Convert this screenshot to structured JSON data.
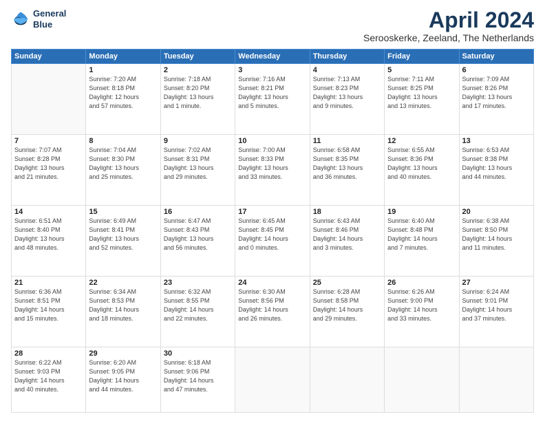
{
  "logo": {
    "line1": "General",
    "line2": "Blue"
  },
  "title": "April 2024",
  "subtitle": "Serooskerke, Zeeland, The Netherlands",
  "days_header": [
    "Sunday",
    "Monday",
    "Tuesday",
    "Wednesday",
    "Thursday",
    "Friday",
    "Saturday"
  ],
  "weeks": [
    [
      {
        "day": "",
        "info": ""
      },
      {
        "day": "1",
        "info": "Sunrise: 7:20 AM\nSunset: 8:18 PM\nDaylight: 12 hours\nand 57 minutes."
      },
      {
        "day": "2",
        "info": "Sunrise: 7:18 AM\nSunset: 8:20 PM\nDaylight: 13 hours\nand 1 minute."
      },
      {
        "day": "3",
        "info": "Sunrise: 7:16 AM\nSunset: 8:21 PM\nDaylight: 13 hours\nand 5 minutes."
      },
      {
        "day": "4",
        "info": "Sunrise: 7:13 AM\nSunset: 8:23 PM\nDaylight: 13 hours\nand 9 minutes."
      },
      {
        "day": "5",
        "info": "Sunrise: 7:11 AM\nSunset: 8:25 PM\nDaylight: 13 hours\nand 13 minutes."
      },
      {
        "day": "6",
        "info": "Sunrise: 7:09 AM\nSunset: 8:26 PM\nDaylight: 13 hours\nand 17 minutes."
      }
    ],
    [
      {
        "day": "7",
        "info": "Sunrise: 7:07 AM\nSunset: 8:28 PM\nDaylight: 13 hours\nand 21 minutes."
      },
      {
        "day": "8",
        "info": "Sunrise: 7:04 AM\nSunset: 8:30 PM\nDaylight: 13 hours\nand 25 minutes."
      },
      {
        "day": "9",
        "info": "Sunrise: 7:02 AM\nSunset: 8:31 PM\nDaylight: 13 hours\nand 29 minutes."
      },
      {
        "day": "10",
        "info": "Sunrise: 7:00 AM\nSunset: 8:33 PM\nDaylight: 13 hours\nand 33 minutes."
      },
      {
        "day": "11",
        "info": "Sunrise: 6:58 AM\nSunset: 8:35 PM\nDaylight: 13 hours\nand 36 minutes."
      },
      {
        "day": "12",
        "info": "Sunrise: 6:55 AM\nSunset: 8:36 PM\nDaylight: 13 hours\nand 40 minutes."
      },
      {
        "day": "13",
        "info": "Sunrise: 6:53 AM\nSunset: 8:38 PM\nDaylight: 13 hours\nand 44 minutes."
      }
    ],
    [
      {
        "day": "14",
        "info": "Sunrise: 6:51 AM\nSunset: 8:40 PM\nDaylight: 13 hours\nand 48 minutes."
      },
      {
        "day": "15",
        "info": "Sunrise: 6:49 AM\nSunset: 8:41 PM\nDaylight: 13 hours\nand 52 minutes."
      },
      {
        "day": "16",
        "info": "Sunrise: 6:47 AM\nSunset: 8:43 PM\nDaylight: 13 hours\nand 56 minutes."
      },
      {
        "day": "17",
        "info": "Sunrise: 6:45 AM\nSunset: 8:45 PM\nDaylight: 14 hours\nand 0 minutes."
      },
      {
        "day": "18",
        "info": "Sunrise: 6:43 AM\nSunset: 8:46 PM\nDaylight: 14 hours\nand 3 minutes."
      },
      {
        "day": "19",
        "info": "Sunrise: 6:40 AM\nSunset: 8:48 PM\nDaylight: 14 hours\nand 7 minutes."
      },
      {
        "day": "20",
        "info": "Sunrise: 6:38 AM\nSunset: 8:50 PM\nDaylight: 14 hours\nand 11 minutes."
      }
    ],
    [
      {
        "day": "21",
        "info": "Sunrise: 6:36 AM\nSunset: 8:51 PM\nDaylight: 14 hours\nand 15 minutes."
      },
      {
        "day": "22",
        "info": "Sunrise: 6:34 AM\nSunset: 8:53 PM\nDaylight: 14 hours\nand 18 minutes."
      },
      {
        "day": "23",
        "info": "Sunrise: 6:32 AM\nSunset: 8:55 PM\nDaylight: 14 hours\nand 22 minutes."
      },
      {
        "day": "24",
        "info": "Sunrise: 6:30 AM\nSunset: 8:56 PM\nDaylight: 14 hours\nand 26 minutes."
      },
      {
        "day": "25",
        "info": "Sunrise: 6:28 AM\nSunset: 8:58 PM\nDaylight: 14 hours\nand 29 minutes."
      },
      {
        "day": "26",
        "info": "Sunrise: 6:26 AM\nSunset: 9:00 PM\nDaylight: 14 hours\nand 33 minutes."
      },
      {
        "day": "27",
        "info": "Sunrise: 6:24 AM\nSunset: 9:01 PM\nDaylight: 14 hours\nand 37 minutes."
      }
    ],
    [
      {
        "day": "28",
        "info": "Sunrise: 6:22 AM\nSunset: 9:03 PM\nDaylight: 14 hours\nand 40 minutes."
      },
      {
        "day": "29",
        "info": "Sunrise: 6:20 AM\nSunset: 9:05 PM\nDaylight: 14 hours\nand 44 minutes."
      },
      {
        "day": "30",
        "info": "Sunrise: 6:18 AM\nSunset: 9:06 PM\nDaylight: 14 hours\nand 47 minutes."
      },
      {
        "day": "",
        "info": ""
      },
      {
        "day": "",
        "info": ""
      },
      {
        "day": "",
        "info": ""
      },
      {
        "day": "",
        "info": ""
      }
    ]
  ]
}
